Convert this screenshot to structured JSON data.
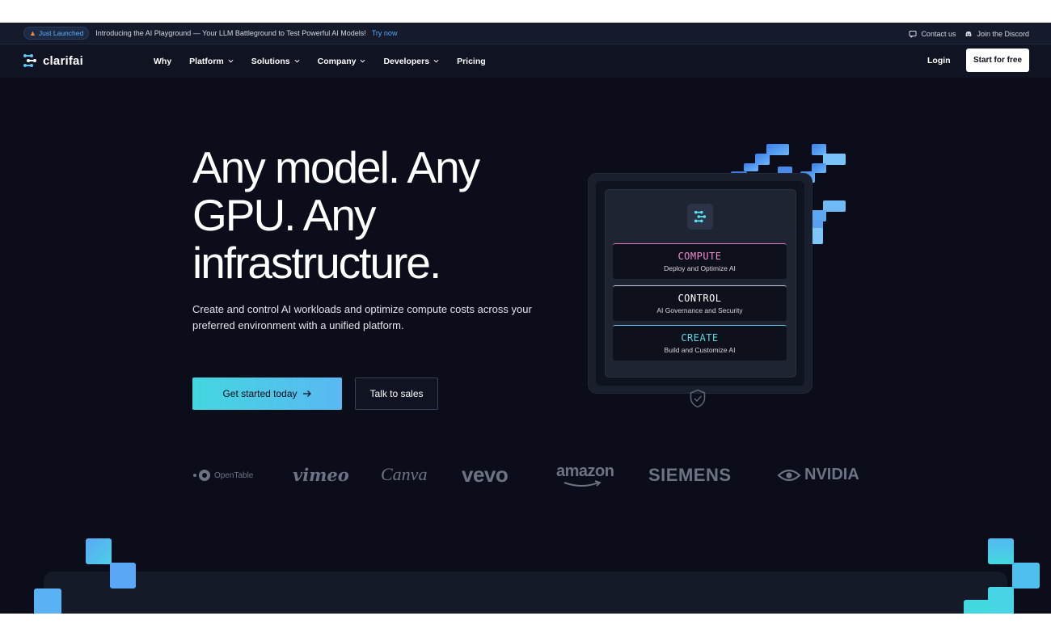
{
  "announcement": {
    "badge": "Just Launched",
    "message": "Introducing the AI Playground — Your LLM Battleground to Test Powerful AI Models!",
    "link": "Try now",
    "contact": "Contact us",
    "discord": "Join the Discord"
  },
  "nav": {
    "brand": "clarifai",
    "items": [
      {
        "label": "Why",
        "dropdown": false
      },
      {
        "label": "Platform",
        "dropdown": true
      },
      {
        "label": "Solutions",
        "dropdown": true
      },
      {
        "label": "Company",
        "dropdown": true
      },
      {
        "label": "Developers",
        "dropdown": true
      },
      {
        "label": "Pricing",
        "dropdown": false
      }
    ],
    "login": "Login",
    "cta": "Start for free"
  },
  "hero": {
    "headline": "Any model. Any GPU. Any infrastructure.",
    "subtext": "Create and control AI workloads and optimize compute costs across your preferred environment with a unified platform.",
    "primary_button": "Get started today",
    "secondary_button": "Talk to sales"
  },
  "card": {
    "rows": [
      {
        "title": "COMPUTE",
        "desc": "Deploy and Optimize AI",
        "color": "#f08bd0",
        "border": "#e97ac8"
      },
      {
        "title": "CONTROL",
        "desc": "AI Governance and Security",
        "color": "#ffffff",
        "border": "#c8cde0"
      },
      {
        "title": "CREATE",
        "desc": "Build and Customize AI",
        "color": "#56d9e6",
        "border": "#5bc8f0"
      }
    ]
  },
  "customers": [
    "OpenTable",
    "vimeo",
    "Canva",
    "vevo",
    "amazon",
    "SIEMENS",
    "NVIDIA"
  ],
  "colors": {
    "accent_cyan": "#43d6df",
    "accent_blue": "#5ab8f2",
    "background": "#0b0e1a"
  }
}
